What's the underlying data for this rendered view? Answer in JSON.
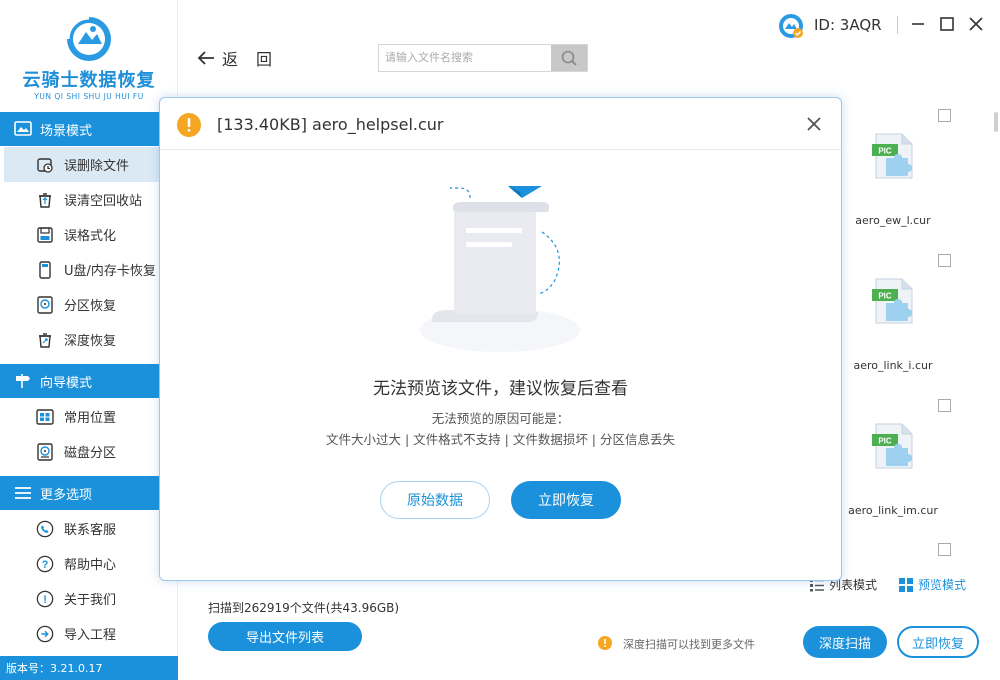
{
  "app": {
    "logo_title": "云骑士数据恢复",
    "logo_subtitle": "YUN QI SHI SHU JU HUI FU",
    "version": "版本号：3.21.0.17",
    "user_id": "ID: 3AQR"
  },
  "colors": {
    "accent": "#1b91db",
    "active_bg": "#dbe9f5",
    "warning": "#f5a623"
  },
  "sidebar": {
    "sections": [
      {
        "label": "场景模式",
        "icon": "scene-icon"
      },
      {
        "label": "向导模式",
        "icon": "signpost-icon"
      },
      {
        "label": "更多选项",
        "icon": "menu-lines-icon"
      }
    ],
    "items": [
      {
        "label": "误删除文件",
        "icon": "deleted-file-icon",
        "active": true
      },
      {
        "label": "误清空回收站",
        "icon": "recycle-bin-icon"
      },
      {
        "label": "误格式化",
        "icon": "format-disk-icon"
      },
      {
        "label": "U盘/内存卡恢复",
        "icon": "usb-drive-icon"
      },
      {
        "label": "分区恢复",
        "icon": "partition-icon"
      },
      {
        "label": "深度恢复",
        "icon": "deep-recover-icon"
      },
      {
        "label": "常用位置",
        "icon": "windows-icon"
      },
      {
        "label": "磁盘分区",
        "icon": "disk-icon"
      },
      {
        "label": "联系客服",
        "icon": "phone-icon"
      },
      {
        "label": "帮助中心",
        "icon": "question-icon"
      },
      {
        "label": "关于我们",
        "icon": "info-icon"
      },
      {
        "label": "导入工程",
        "icon": "import-icon"
      }
    ]
  },
  "toolbar": {
    "back_label": "返回",
    "search_placeholder": "请输入文件名搜索"
  },
  "files": [
    {
      "name": "aero_ew_l.cur",
      "icon": "pic-file-icon"
    },
    {
      "name": "aero_link_i.cur",
      "icon": "pic-file-icon"
    },
    {
      "name": "aero_link_im.cur",
      "icon": "pic-file-icon"
    }
  ],
  "view_modes": {
    "list": "列表模式",
    "preview": "预览模式"
  },
  "bottom": {
    "scan_info": "扫描到262919个文件(共43.96GB)",
    "export_label": "导出文件列表",
    "tip": "深度扫描可以找到更多文件",
    "deep_scan_label": "深度扫描",
    "recover_label": "立即恢复"
  },
  "dialog": {
    "title": "[133.40KB] aero_helpsel.cur",
    "message": "无法预览该文件，建议恢复后查看",
    "reason_title": "无法预览的原因可能是：",
    "reasons": "文件大小过大 | 文件格式不支持 | 文件数据损坏 | 分区信息丢失",
    "raw_data_label": "原始数据",
    "recover_label": "立即恢复"
  }
}
